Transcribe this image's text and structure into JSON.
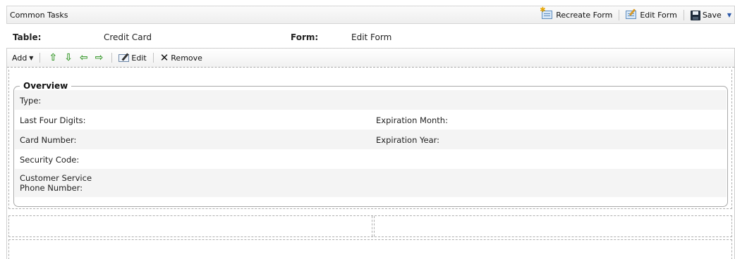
{
  "topbar": {
    "title": "Common Tasks",
    "recreate_form": "Recreate Form",
    "edit_form": "Edit Form",
    "save": "Save"
  },
  "header": {
    "table_label": "Table:",
    "table_value": "Credit Card",
    "form_label": "Form:",
    "form_value": "Edit Form"
  },
  "subtoolbar": {
    "add": "Add",
    "edit": "Edit",
    "remove": "Remove"
  },
  "overview": {
    "legend": "Overview",
    "fields": {
      "type": "Type:",
      "last_four": "Last Four Digits:",
      "expiration_month": "Expiration Month:",
      "card_number": "Card Number:",
      "expiration_year": "Expiration Year:",
      "security_code": "Security Code:",
      "phone_line1": "Customer Service",
      "phone_line2": "Phone Number:"
    }
  }
}
